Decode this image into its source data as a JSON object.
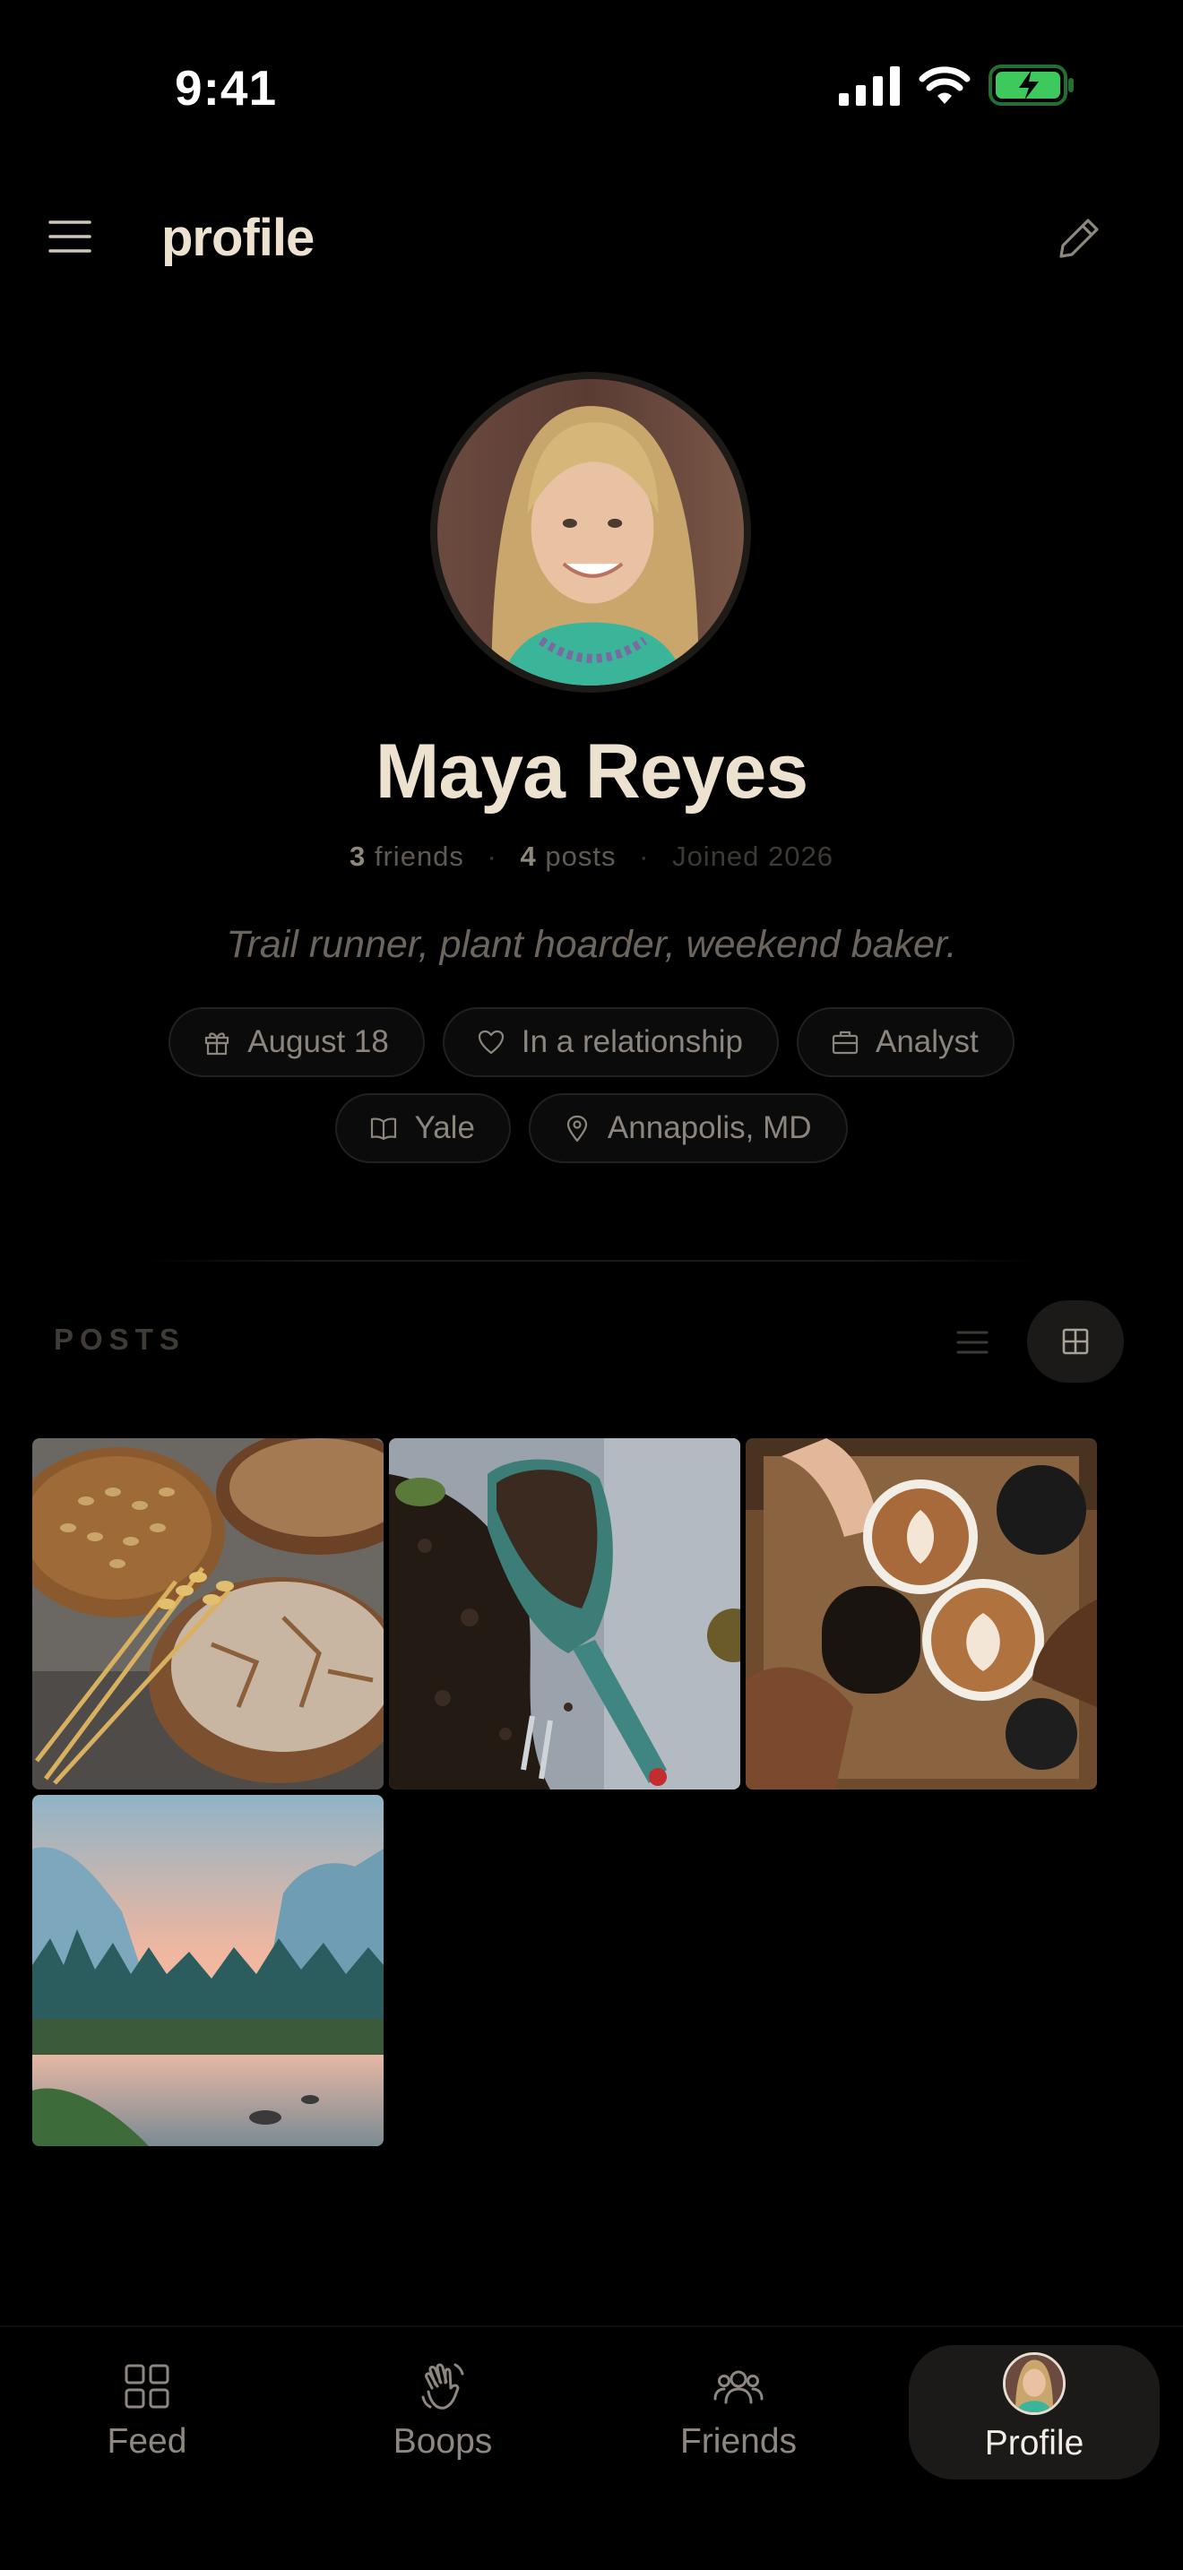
{
  "status_bar": {
    "time": "9:41"
  },
  "header": {
    "title": "profile"
  },
  "profile": {
    "name": "Maya Reyes",
    "friends_count": "3",
    "friends_label": "friends",
    "posts_count": "4",
    "posts_label": "posts",
    "joined": "Joined 2026",
    "bio": "Trail runner, plant hoarder, weekend baker.",
    "chips": [
      {
        "icon": "gift-icon",
        "label": "August 18"
      },
      {
        "icon": "heart-icon",
        "label": "In a relationship"
      },
      {
        "icon": "briefcase-icon",
        "label": "Analyst"
      },
      {
        "icon": "book-icon",
        "label": "Yale"
      },
      {
        "icon": "location-pin-icon",
        "label": "Annapolis, MD"
      }
    ]
  },
  "posts": {
    "label": "POSTS",
    "items": [
      {
        "subject": "bread"
      },
      {
        "subject": "soil-scoop"
      },
      {
        "subject": "coffee-cheers"
      },
      {
        "subject": "mountain-river"
      }
    ]
  },
  "tab_bar": {
    "tabs": [
      {
        "label": "Feed",
        "icon": "grid-icon",
        "active": false
      },
      {
        "label": "Boops",
        "icon": "waving-hand-icon",
        "active": false
      },
      {
        "label": "Friends",
        "icon": "people-icon",
        "active": false
      },
      {
        "label": "Profile",
        "icon": "avatar",
        "active": true
      }
    ]
  },
  "colors": {
    "background": "#000000",
    "title_text": "#ece2cf",
    "muted_text": "#8b857d",
    "chip_border": "#232120",
    "active_tab_bg": "#1b1a19",
    "battery_green": "#3ec95c"
  }
}
